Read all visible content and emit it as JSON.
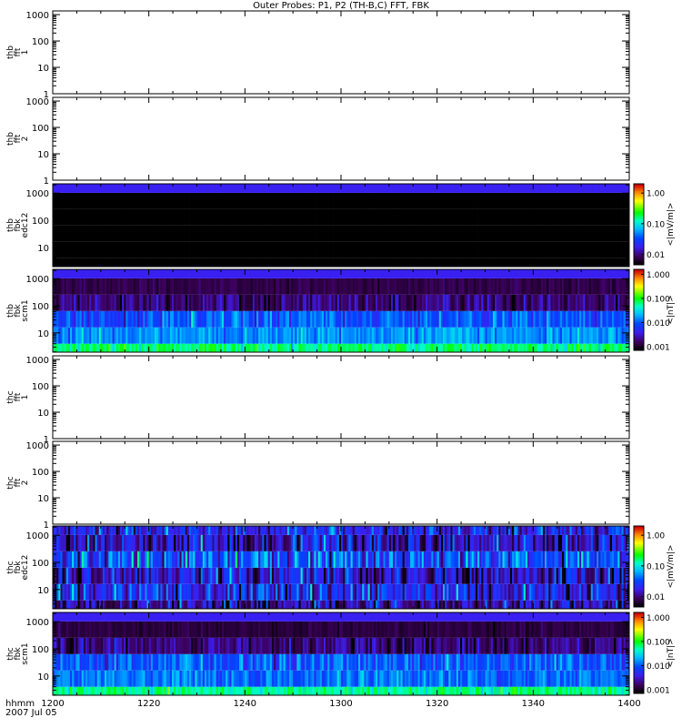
{
  "title": "Outer Probes: P1, P2 (TH-B,C) FFT, FBK",
  "xaxis": {
    "label": "hhmm",
    "date": "2007 Jul 05",
    "ticks": [
      "1200",
      "1220",
      "1240",
      "1300",
      "1320",
      "1340",
      "1400"
    ],
    "range_minutes": [
      0,
      120
    ]
  },
  "chart_data": [
    {
      "type": "heatmap",
      "probe": "thb",
      "label": [
        "thb",
        "fft",
        "1"
      ],
      "yticks": [
        "1",
        "10",
        "100",
        "1000"
      ],
      "yrange": [
        1,
        1380
      ],
      "empty": true
    },
    {
      "type": "heatmap",
      "probe": "thb",
      "label": [
        "thb",
        "fft",
        "2"
      ],
      "yticks": [
        "1",
        "10",
        "100",
        "1000"
      ],
      "yrange": [
        1,
        1380
      ],
      "empty": true
    },
    {
      "type": "heatmap",
      "probe": "thb",
      "label": [
        "thb",
        "fbk",
        "edc12"
      ],
      "yticks": [
        "10",
        "100",
        "1000"
      ],
      "yrange": [
        1.95,
        2200
      ],
      "colorbar": {
        "ticks": [
          "0.01",
          "0.10",
          "1.00"
        ],
        "tick_values": [
          0.01,
          0.1,
          1
        ],
        "range": [
          0.0046,
          2.0
        ],
        "label": "<|mV/m|>"
      },
      "bands_hz": [
        2,
        4,
        16,
        64,
        256,
        1024,
        2200
      ],
      "band_median": [
        0.003,
        0.003,
        0.003,
        0.003,
        0.003,
        0.018
      ],
      "band_spread_decades": [
        0,
        0,
        0,
        0,
        0,
        0
      ]
    },
    {
      "type": "heatmap",
      "probe": "thb",
      "label": [
        "thb",
        "fbk",
        "scm1"
      ],
      "yticks": [
        "10",
        "100",
        "1000"
      ],
      "yrange": [
        1.95,
        2200
      ],
      "colorbar": {
        "ticks": [
          "0.001",
          "0.010",
          "0.100",
          "1.000"
        ],
        "tick_values": [
          0.001,
          0.01,
          0.1,
          1
        ],
        "range": [
          0.0007,
          1.6
        ],
        "label": "<|nT|>"
      },
      "bands_hz": [
        2,
        4,
        16,
        64,
        256,
        1024,
        2200
      ],
      "band_median": [
        0.07,
        0.016,
        0.009,
        0.0018,
        0.0013,
        0.004
      ],
      "band_spread_decades": [
        0.25,
        0.25,
        0.35,
        0.3,
        0.1,
        0
      ]
    },
    {
      "type": "heatmap",
      "probe": "thc",
      "label": [
        "thc",
        "fft",
        "1"
      ],
      "yticks": [
        "1",
        "10",
        "100",
        "1000"
      ],
      "yrange": [
        1,
        1380
      ],
      "empty": true
    },
    {
      "type": "heatmap",
      "probe": "thc",
      "label": [
        "thc",
        "fft",
        "2"
      ],
      "yticks": [
        "1",
        "10",
        "100",
        "1000"
      ],
      "yrange": [
        1,
        1380
      ],
      "empty": true
    },
    {
      "type": "heatmap",
      "probe": "thc",
      "label": [
        "thc",
        "fbk",
        "edc12"
      ],
      "yticks": [
        "10",
        "100",
        "1000"
      ],
      "yrange": [
        1.95,
        2200
      ],
      "colorbar": {
        "ticks": [
          "0.01",
          "0.10",
          "1.00"
        ],
        "tick_values": [
          0.01,
          0.1,
          1
        ],
        "range": [
          0.0046,
          2.0
        ],
        "label": "<|mV/m|>"
      },
      "bands_hz": [
        2,
        4,
        16,
        64,
        256,
        1024,
        2200
      ],
      "band_median": [
        0.012,
        0.02,
        0.015,
        0.03,
        0.015,
        0.02
      ],
      "band_spread_decades": [
        0.45,
        0.45,
        0.45,
        0.45,
        0.45,
        0.4
      ]
    },
    {
      "type": "heatmap",
      "probe": "thc",
      "label": [
        "thc",
        "fbk",
        "scm1"
      ],
      "yticks": [
        "10",
        "100",
        "1000"
      ],
      "yrange": [
        1.95,
        2200
      ],
      "colorbar": {
        "ticks": [
          "0.001",
          "0.010",
          "0.100",
          "1.000"
        ],
        "tick_values": [
          0.001,
          0.01,
          0.1,
          1
        ],
        "range": [
          0.0007,
          1.6
        ],
        "label": "<|nT|>"
      },
      "bands_hz": [
        2,
        4,
        16,
        64,
        256,
        1024,
        2200
      ],
      "band_median": [
        0.06,
        0.012,
        0.01,
        0.0018,
        0.0012,
        0.004
      ],
      "band_spread_decades": [
        0.25,
        0.3,
        0.35,
        0.3,
        0.1,
        0
      ]
    }
  ]
}
